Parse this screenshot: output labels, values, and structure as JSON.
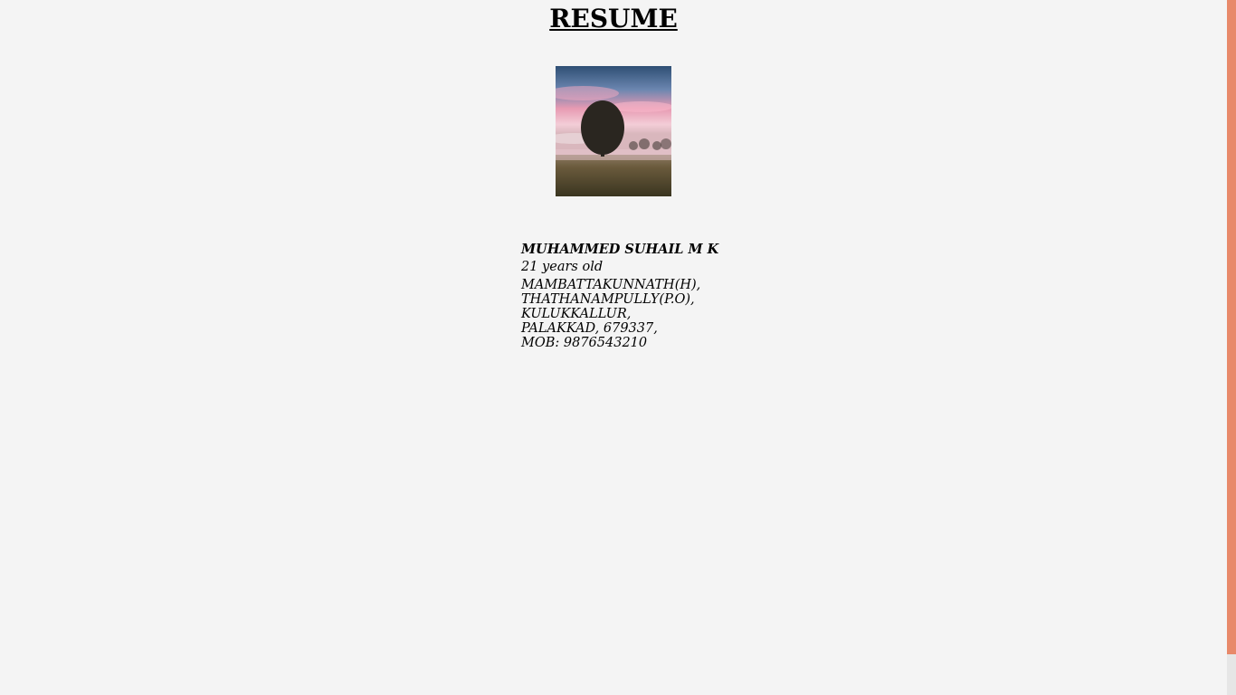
{
  "page": {
    "title": "RESUME",
    "photo_alt": "profile-photo"
  },
  "person": {
    "name": "MUHAMMED SUHAIL M K",
    "age": "21 years old",
    "address": {
      "line1": "MAMBATTAKUNNATH(H),",
      "line2": "THATHANAMPULLY(P.O),",
      "line3": "KULUKKALLUR,",
      "line4": "PALAKKAD, 679337,",
      "phone": "MOB: 9876543210"
    }
  },
  "colors": {
    "background": "#f4f4f4",
    "scrollbar_thumb": "#e8896a"
  }
}
